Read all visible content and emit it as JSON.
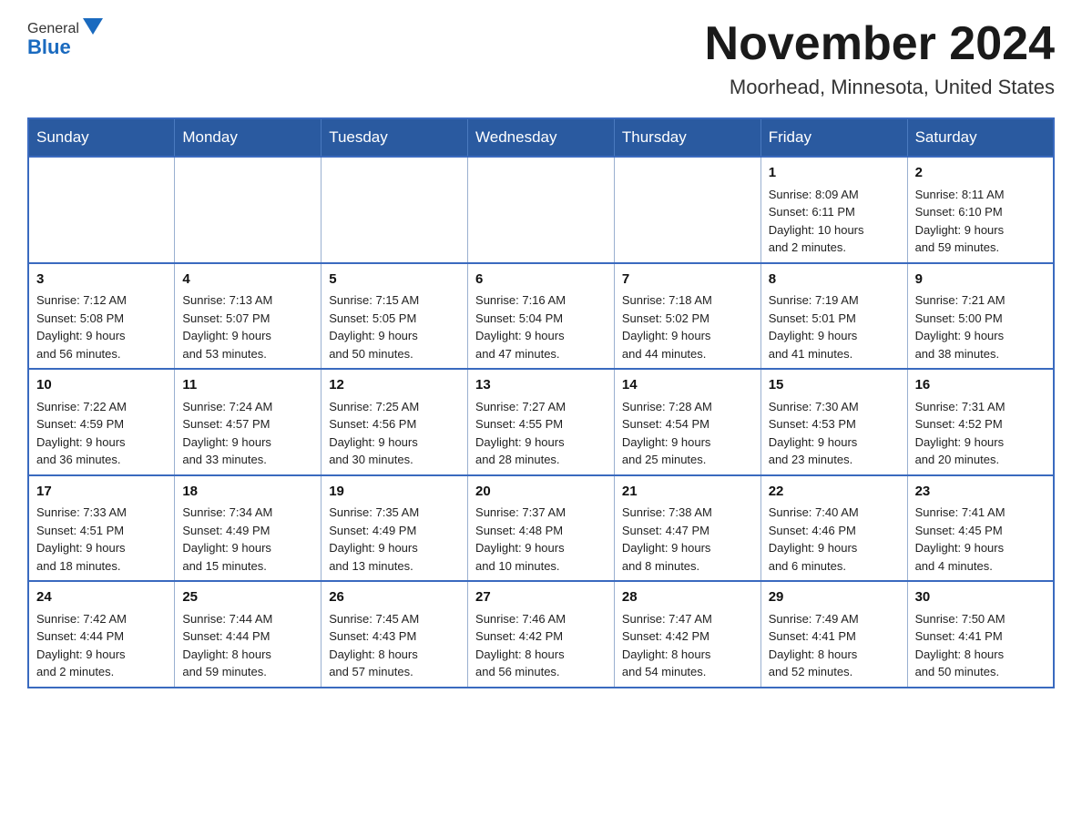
{
  "header": {
    "logo_general": "General",
    "logo_blue": "Blue",
    "month_title": "November 2024",
    "location": "Moorhead, Minnesota, United States"
  },
  "days_of_week": [
    "Sunday",
    "Monday",
    "Tuesday",
    "Wednesday",
    "Thursday",
    "Friday",
    "Saturday"
  ],
  "weeks": [
    [
      {
        "day": "",
        "info": ""
      },
      {
        "day": "",
        "info": ""
      },
      {
        "day": "",
        "info": ""
      },
      {
        "day": "",
        "info": ""
      },
      {
        "day": "",
        "info": ""
      },
      {
        "day": "1",
        "info": "Sunrise: 8:09 AM\nSunset: 6:11 PM\nDaylight: 10 hours\nand 2 minutes."
      },
      {
        "day": "2",
        "info": "Sunrise: 8:11 AM\nSunset: 6:10 PM\nDaylight: 9 hours\nand 59 minutes."
      }
    ],
    [
      {
        "day": "3",
        "info": "Sunrise: 7:12 AM\nSunset: 5:08 PM\nDaylight: 9 hours\nand 56 minutes."
      },
      {
        "day": "4",
        "info": "Sunrise: 7:13 AM\nSunset: 5:07 PM\nDaylight: 9 hours\nand 53 minutes."
      },
      {
        "day": "5",
        "info": "Sunrise: 7:15 AM\nSunset: 5:05 PM\nDaylight: 9 hours\nand 50 minutes."
      },
      {
        "day": "6",
        "info": "Sunrise: 7:16 AM\nSunset: 5:04 PM\nDaylight: 9 hours\nand 47 minutes."
      },
      {
        "day": "7",
        "info": "Sunrise: 7:18 AM\nSunset: 5:02 PM\nDaylight: 9 hours\nand 44 minutes."
      },
      {
        "day": "8",
        "info": "Sunrise: 7:19 AM\nSunset: 5:01 PM\nDaylight: 9 hours\nand 41 minutes."
      },
      {
        "day": "9",
        "info": "Sunrise: 7:21 AM\nSunset: 5:00 PM\nDaylight: 9 hours\nand 38 minutes."
      }
    ],
    [
      {
        "day": "10",
        "info": "Sunrise: 7:22 AM\nSunset: 4:59 PM\nDaylight: 9 hours\nand 36 minutes."
      },
      {
        "day": "11",
        "info": "Sunrise: 7:24 AM\nSunset: 4:57 PM\nDaylight: 9 hours\nand 33 minutes."
      },
      {
        "day": "12",
        "info": "Sunrise: 7:25 AM\nSunset: 4:56 PM\nDaylight: 9 hours\nand 30 minutes."
      },
      {
        "day": "13",
        "info": "Sunrise: 7:27 AM\nSunset: 4:55 PM\nDaylight: 9 hours\nand 28 minutes."
      },
      {
        "day": "14",
        "info": "Sunrise: 7:28 AM\nSunset: 4:54 PM\nDaylight: 9 hours\nand 25 minutes."
      },
      {
        "day": "15",
        "info": "Sunrise: 7:30 AM\nSunset: 4:53 PM\nDaylight: 9 hours\nand 23 minutes."
      },
      {
        "day": "16",
        "info": "Sunrise: 7:31 AM\nSunset: 4:52 PM\nDaylight: 9 hours\nand 20 minutes."
      }
    ],
    [
      {
        "day": "17",
        "info": "Sunrise: 7:33 AM\nSunset: 4:51 PM\nDaylight: 9 hours\nand 18 minutes."
      },
      {
        "day": "18",
        "info": "Sunrise: 7:34 AM\nSunset: 4:49 PM\nDaylight: 9 hours\nand 15 minutes."
      },
      {
        "day": "19",
        "info": "Sunrise: 7:35 AM\nSunset: 4:49 PM\nDaylight: 9 hours\nand 13 minutes."
      },
      {
        "day": "20",
        "info": "Sunrise: 7:37 AM\nSunset: 4:48 PM\nDaylight: 9 hours\nand 10 minutes."
      },
      {
        "day": "21",
        "info": "Sunrise: 7:38 AM\nSunset: 4:47 PM\nDaylight: 9 hours\nand 8 minutes."
      },
      {
        "day": "22",
        "info": "Sunrise: 7:40 AM\nSunset: 4:46 PM\nDaylight: 9 hours\nand 6 minutes."
      },
      {
        "day": "23",
        "info": "Sunrise: 7:41 AM\nSunset: 4:45 PM\nDaylight: 9 hours\nand 4 minutes."
      }
    ],
    [
      {
        "day": "24",
        "info": "Sunrise: 7:42 AM\nSunset: 4:44 PM\nDaylight: 9 hours\nand 2 minutes."
      },
      {
        "day": "25",
        "info": "Sunrise: 7:44 AM\nSunset: 4:44 PM\nDaylight: 8 hours\nand 59 minutes."
      },
      {
        "day": "26",
        "info": "Sunrise: 7:45 AM\nSunset: 4:43 PM\nDaylight: 8 hours\nand 57 minutes."
      },
      {
        "day": "27",
        "info": "Sunrise: 7:46 AM\nSunset: 4:42 PM\nDaylight: 8 hours\nand 56 minutes."
      },
      {
        "day": "28",
        "info": "Sunrise: 7:47 AM\nSunset: 4:42 PM\nDaylight: 8 hours\nand 54 minutes."
      },
      {
        "day": "29",
        "info": "Sunrise: 7:49 AM\nSunset: 4:41 PM\nDaylight: 8 hours\nand 52 minutes."
      },
      {
        "day": "30",
        "info": "Sunrise: 7:50 AM\nSunset: 4:41 PM\nDaylight: 8 hours\nand 50 minutes."
      }
    ]
  ]
}
